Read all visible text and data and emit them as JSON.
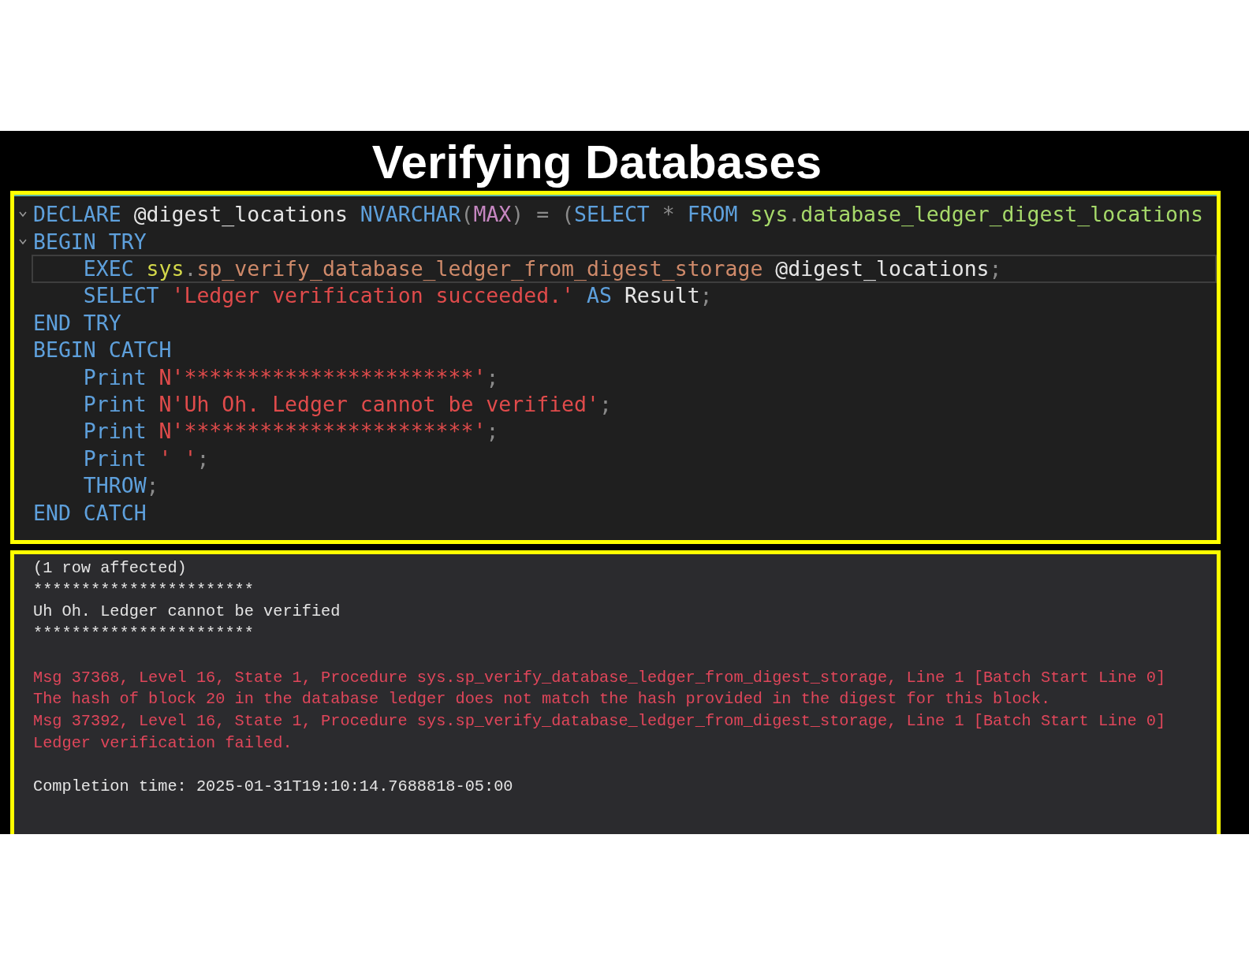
{
  "title": "Verifying Databases",
  "editor": {
    "lines": [
      {
        "fold": true,
        "current": false,
        "tokens": [
          {
            "text": "DECLARE ",
            "kind": "keyword"
          },
          {
            "text": "@digest_locations ",
            "kind": "variable"
          },
          {
            "text": "NVARCHAR",
            "kind": "keyword"
          },
          {
            "text": "(",
            "kind": "punct"
          },
          {
            "text": "MAX",
            "kind": "constant"
          },
          {
            "text": ") = (",
            "kind": "punct"
          },
          {
            "text": "SELECT ",
            "kind": "keyword"
          },
          {
            "text": "* ",
            "kind": "punct"
          },
          {
            "text": "FROM ",
            "kind": "keyword"
          },
          {
            "text": "sys",
            "kind": "object"
          },
          {
            "text": ".",
            "kind": "punct"
          },
          {
            "text": "database_ledger_digest_locations",
            "kind": "object"
          }
        ]
      },
      {
        "fold": true,
        "current": false,
        "tokens": [
          {
            "text": "BEGIN TRY",
            "kind": "keyword"
          }
        ]
      },
      {
        "fold": false,
        "current": true,
        "tokens": [
          {
            "text": "    EXEC ",
            "kind": "keyword"
          },
          {
            "text": "sys",
            "kind": "schema"
          },
          {
            "text": ".",
            "kind": "punct"
          },
          {
            "text": "sp_verify_database_ledger_from_digest_storage ",
            "kind": "procedure"
          },
          {
            "text": "@digest_locations",
            "kind": "variable"
          },
          {
            "text": ";",
            "kind": "punct"
          }
        ]
      },
      {
        "fold": false,
        "current": false,
        "tokens": [
          {
            "text": "    SELECT ",
            "kind": "keyword"
          },
          {
            "text": "'Ledger verification succeeded.' ",
            "kind": "string"
          },
          {
            "text": "AS ",
            "kind": "keyword"
          },
          {
            "text": "Result",
            "kind": "variable"
          },
          {
            "text": ";",
            "kind": "punct"
          }
        ]
      },
      {
        "fold": false,
        "current": false,
        "tokens": [
          {
            "text": "END TRY",
            "kind": "keyword"
          }
        ]
      },
      {
        "fold": false,
        "current": false,
        "tokens": [
          {
            "text": "BEGIN CATCH",
            "kind": "keyword"
          }
        ]
      },
      {
        "fold": false,
        "current": false,
        "tokens": [
          {
            "text": "    Print ",
            "kind": "keyword"
          },
          {
            "text": "N'***********************'",
            "kind": "string"
          },
          {
            "text": ";",
            "kind": "punct"
          }
        ]
      },
      {
        "fold": false,
        "current": false,
        "tokens": [
          {
            "text": "    Print ",
            "kind": "keyword"
          },
          {
            "text": "N'Uh Oh. Ledger cannot be verified'",
            "kind": "string"
          },
          {
            "text": ";",
            "kind": "punct"
          }
        ]
      },
      {
        "fold": false,
        "current": false,
        "tokens": [
          {
            "text": "    Print ",
            "kind": "keyword"
          },
          {
            "text": "N'***********************'",
            "kind": "string"
          },
          {
            "text": ";",
            "kind": "punct"
          }
        ]
      },
      {
        "fold": false,
        "current": false,
        "tokens": [
          {
            "text": "    Print ",
            "kind": "keyword"
          },
          {
            "text": "' '",
            "kind": "string"
          },
          {
            "text": ";",
            "kind": "punct"
          }
        ]
      },
      {
        "fold": false,
        "current": false,
        "tokens": [
          {
            "text": "    THROW",
            "kind": "keyword"
          },
          {
            "text": ";",
            "kind": "punct"
          }
        ]
      },
      {
        "fold": false,
        "current": false,
        "tokens": [
          {
            "text": "END CATCH",
            "kind": "keyword"
          }
        ]
      }
    ]
  },
  "output": {
    "lines": [
      {
        "kind": "message",
        "text": "(1 row affected)"
      },
      {
        "kind": "message",
        "text": "***********************"
      },
      {
        "kind": "message",
        "text": "Uh Oh. Ledger cannot be verified"
      },
      {
        "kind": "message",
        "text": "***********************"
      },
      {
        "kind": "blank"
      },
      {
        "kind": "error",
        "text": "Msg 37368, Level 16, State 1, Procedure sys.sp_verify_database_ledger_from_digest_storage, Line 1 [Batch Start Line 0]"
      },
      {
        "kind": "error",
        "text": "The hash of block 20 in the database ledger does not match the hash provided in the digest for this block."
      },
      {
        "kind": "error",
        "text": "Msg 37392, Level 16, State 1, Procedure sys.sp_verify_database_ledger_from_digest_storage, Line 1 [Batch Start Line 0]"
      },
      {
        "kind": "error",
        "text": "Ledger verification failed."
      },
      {
        "kind": "blank"
      },
      {
        "kind": "message",
        "text": "Completion time: 2025-01-31T19:10:14.7688818-05:00"
      }
    ]
  }
}
